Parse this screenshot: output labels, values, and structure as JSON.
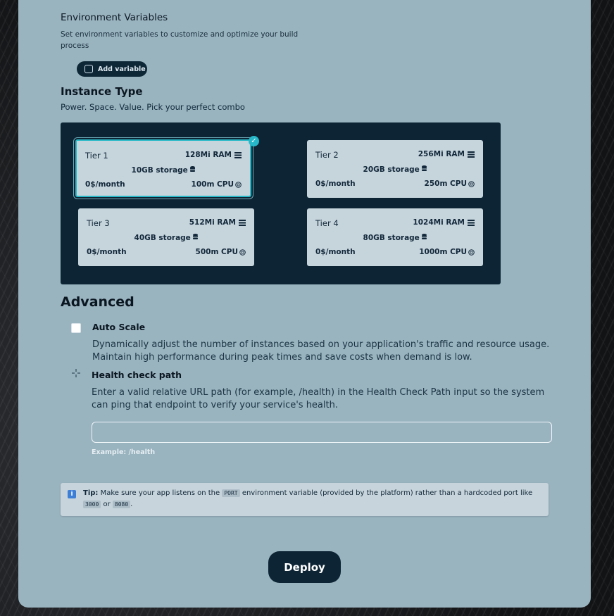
{
  "env": {
    "title": "Environment Variables",
    "description": "Set environment variables to customize and optimize your build process",
    "add_button": "Add variable"
  },
  "instance": {
    "title": "Instance Type",
    "subtitle": "Power. Space. Value. Pick your perfect combo",
    "selected": "Tier 1",
    "tiers": [
      {
        "name": "Tier 1",
        "ram": "128Mi RAM",
        "storage": "10GB storage",
        "price": "0$/month",
        "cpu": "100m CPU"
      },
      {
        "name": "Tier 2",
        "ram": "256Mi RAM",
        "storage": "20GB storage",
        "price": "0$/month",
        "cpu": "250m CPU"
      },
      {
        "name": "Tier 3",
        "ram": "512Mi RAM",
        "storage": "40GB storage",
        "price": "0$/month",
        "cpu": "500m CPU"
      },
      {
        "name": "Tier 4",
        "ram": "1024Mi RAM",
        "storage": "80GB storage",
        "price": "0$/month",
        "cpu": "1000m CPU"
      }
    ]
  },
  "advanced": {
    "title": "Advanced",
    "auto_scale": {
      "label": "Auto Scale",
      "checked": false,
      "description": "Dynamically adjust the number of instances based on your application's traffic and resource usage. Maintain high performance during peak times and save costs when demand is low."
    },
    "health_check": {
      "label": "Health check path",
      "description": "Enter a valid relative URL path (for example, /health) in the Health Check Path input so the system can ping that endpoint to verify your service's health.",
      "value": "",
      "example": "Example: /health"
    }
  },
  "tip": {
    "label": "Tip:",
    "text_1": "Make sure your app listens on the",
    "code_port": "PORT",
    "text_2": "environment variable (provided by the platform) rather than a hardcoded port like",
    "code_3000": "3000",
    "text_or": "or",
    "code_8080": "8080",
    "text_end": "."
  },
  "deploy_label": "Deploy",
  "colors": {
    "panel": "#99b3bf",
    "dark": "#0c2434",
    "accent": "#27b9c9",
    "tier_card": "#c6d4dc"
  }
}
